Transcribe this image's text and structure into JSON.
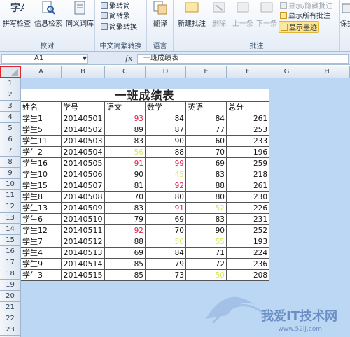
{
  "ribbon": {
    "proofing": {
      "group": "校对",
      "spell": "拼写检查",
      "research": "信息检索",
      "thesaurus": "同义词库"
    },
    "chinese": {
      "group": "中文简繁转换",
      "t2s": "繁转简",
      "s2t": "简转繁",
      "convert": "简繁转换"
    },
    "language": {
      "group": "语言",
      "translate": "翻译"
    },
    "comments": {
      "group": "批注",
      "new": "新建批注",
      "delete": "删除",
      "prev": "上一条",
      "next": "下一条",
      "showhide": "显示/隐藏批注",
      "showall": "显示所有批注",
      "ink": "显示墨迹"
    },
    "cut": "保护工"
  },
  "formula_bar": {
    "cell": "A1",
    "fx": "fx",
    "content": "一班成绩表"
  },
  "columns": [
    "A",
    "B",
    "C",
    "D",
    "E",
    "F",
    "G",
    "H"
  ],
  "rows": [
    "1",
    "2",
    "3",
    "4",
    "5",
    "6",
    "7",
    "8",
    "9",
    "10",
    "11",
    "12",
    "13",
    "14",
    "15",
    "16",
    "17",
    "18",
    "19",
    "20",
    "21",
    "22",
    "23",
    "24"
  ],
  "table": {
    "title": "一班成绩表",
    "headers": [
      "姓名",
      "学号",
      "语文",
      "数学",
      "英语",
      "总分"
    ],
    "rows": [
      [
        "学生1",
        "20140501",
        "93",
        "84",
        "84",
        "261"
      ],
      [
        "学生5",
        "20140502",
        "89",
        "87",
        "77",
        "253"
      ],
      [
        "学生11",
        "20140503",
        "83",
        "90",
        "60",
        "233"
      ],
      [
        "学生2",
        "20140504",
        "56",
        "88",
        "70",
        "196"
      ],
      [
        "学生16",
        "20140505",
        "91",
        "99",
        "69",
        "259"
      ],
      [
        "学生10",
        "20140506",
        "90",
        "45",
        "83",
        "218"
      ],
      [
        "学生15",
        "20140507",
        "81",
        "92",
        "88",
        "261"
      ],
      [
        "学生8",
        "20140508",
        "70",
        "80",
        "80",
        "230"
      ],
      [
        "学生13",
        "20140509",
        "83",
        "91",
        "52",
        "226"
      ],
      [
        "学生6",
        "20140510",
        "79",
        "69",
        "83",
        "231"
      ],
      [
        "学生12",
        "20140511",
        "92",
        "70",
        "90",
        "252"
      ],
      [
        "学生7",
        "20140512",
        "88",
        "50",
        "55",
        "193"
      ],
      [
        "学生4",
        "20140513",
        "69",
        "84",
        "71",
        "224"
      ],
      [
        "学生9",
        "20140514",
        "85",
        "79",
        "72",
        "236"
      ],
      [
        "学生3",
        "20140515",
        "85",
        "73",
        "50",
        "208"
      ]
    ],
    "highlight": {
      "red": [
        [
          0,
          2
        ],
        [
          4,
          2
        ],
        [
          4,
          3
        ],
        [
          6,
          3
        ],
        [
          8,
          3
        ],
        [
          10,
          2
        ]
      ],
      "yellow": [
        [
          3,
          2
        ],
        [
          5,
          3
        ],
        [
          8,
          4
        ],
        [
          11,
          3
        ],
        [
          11,
          4
        ],
        [
          14,
          4
        ]
      ]
    }
  },
  "watermark": {
    "text": "我爱IT技术网",
    "url": "www.52ij.com"
  },
  "colors": {
    "red": "#e0204a",
    "yellow": "#d9e860",
    "selection": "#bcd7f3",
    "corner_outline": "#e0242c"
  }
}
